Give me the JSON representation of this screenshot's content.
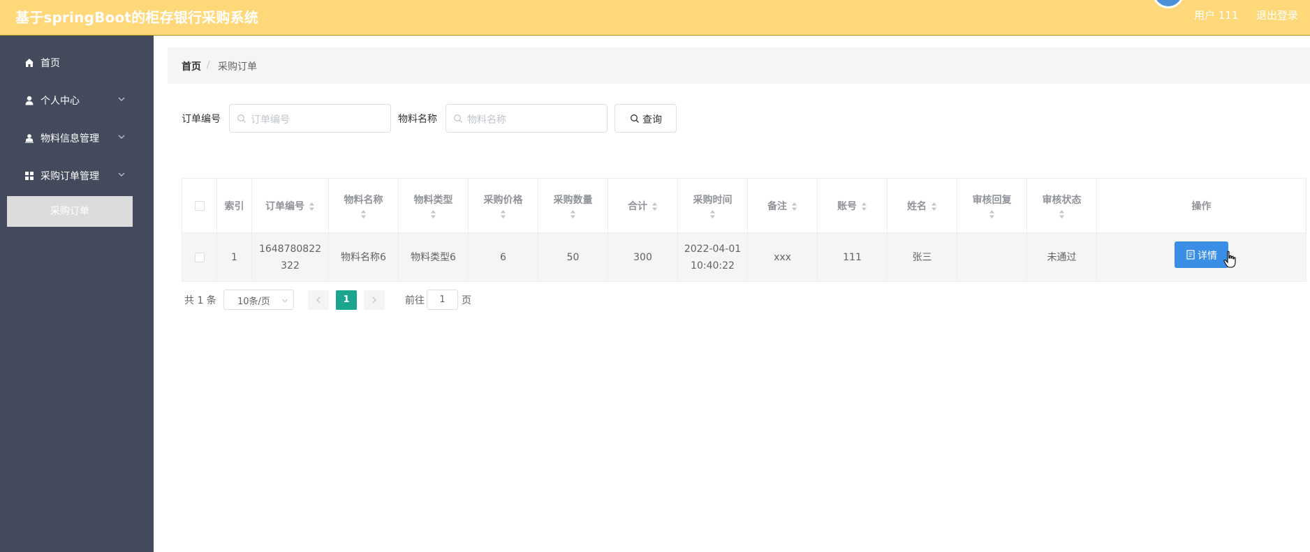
{
  "header": {
    "title": "基于springBoot的柜存银行采购系统",
    "user": "用户 111",
    "logout": "退出登录"
  },
  "sidebar": {
    "items": [
      {
        "label": "首页",
        "icon": "home-icon"
      },
      {
        "label": "个人中心",
        "icon": "user-icon"
      },
      {
        "label": "物料信息管理",
        "icon": "user-card-icon"
      },
      {
        "label": "采购订单管理",
        "icon": "grid-icon"
      }
    ],
    "active_sub": "采购订单"
  },
  "breadcrumb": {
    "home": "首页",
    "separator": "/",
    "current": "采购订单"
  },
  "search": {
    "order_label": "订单编号",
    "order_placeholder": "订单编号",
    "material_label": "物料名称",
    "material_placeholder": "物料名称",
    "query_button": "查询"
  },
  "table": {
    "headers": [
      "索引",
      "订单编号",
      "物料名称",
      "物料类型",
      "采购价格",
      "采购数量",
      "合计",
      "采购时间",
      "备注",
      "账号",
      "姓名",
      "审核回复",
      "审核状态",
      "操作"
    ],
    "rows": [
      {
        "index": "1",
        "order_no_1": "1648780822",
        "order_no_2": "322",
        "material_name": "物料名称6",
        "material_type": "物料类型6",
        "price": "6",
        "quantity": "50",
        "total": "300",
        "time_date": "2022-04-01",
        "time_clock": "10:40:22",
        "remark": "xxx",
        "account": "111",
        "name": "张三",
        "review_reply": "",
        "review_status": "未通过",
        "action": "详情"
      }
    ]
  },
  "pagination": {
    "total": "共 1 条",
    "page_size": "10条/页",
    "current_page": "1",
    "goto_label": "前往",
    "goto_value": "1",
    "goto_unit": "页"
  },
  "colors": {
    "header_bg": "#ffd87a",
    "sidebar_bg": "#424a5c",
    "primary_button": "#3a8ee6",
    "active_page": "#1ba58e"
  }
}
